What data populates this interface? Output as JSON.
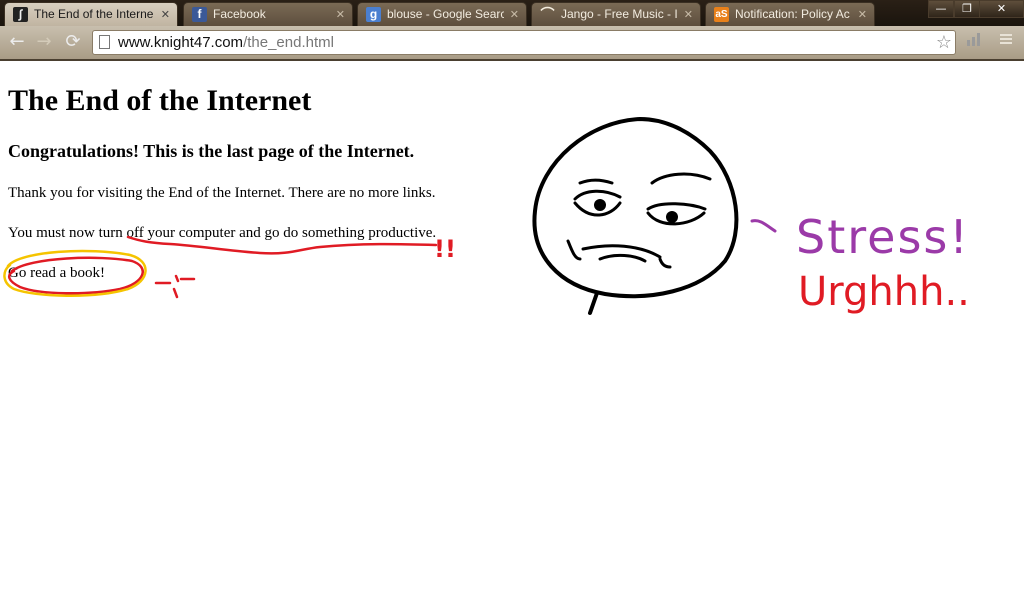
{
  "browser": {
    "tabs": [
      {
        "title": "The End of the Interne",
        "favicon": "figure-favicon",
        "active": true
      },
      {
        "title": "Facebook",
        "favicon": "facebook-favicon",
        "active": false
      },
      {
        "title": "blouse - Google Searcl",
        "favicon": "google-favicon",
        "active": false
      },
      {
        "title": "Jango - Free Music - Ir",
        "favicon": "jango-favicon",
        "active": false
      },
      {
        "title": "Notification: Policy Ac",
        "favicon": "policy-favicon",
        "active": false
      }
    ],
    "url_host": "www.knight47.com",
    "url_path": "/the_end.html",
    "colors": {
      "chrome": "#5d4e3d",
      "toolbar": "#b8ad98"
    }
  },
  "page": {
    "title": "The End of the Internet",
    "subtitle": "Congratulations! This is the last page of the Internet.",
    "para1": "Thank you for visiting the End of the Internet. There are no more links.",
    "para2": "You must now turn off your computer and go do something productive.",
    "para3": "Go read a book!"
  },
  "annotations": {
    "exclaim": "!!",
    "tears_face": "-;-",
    "stress_text": "Stress!",
    "urgh_text": "Urghhh..",
    "colors": {
      "red": "#e01b24",
      "yellow": "#f5c400",
      "purple": "#9b3aa8"
    }
  }
}
